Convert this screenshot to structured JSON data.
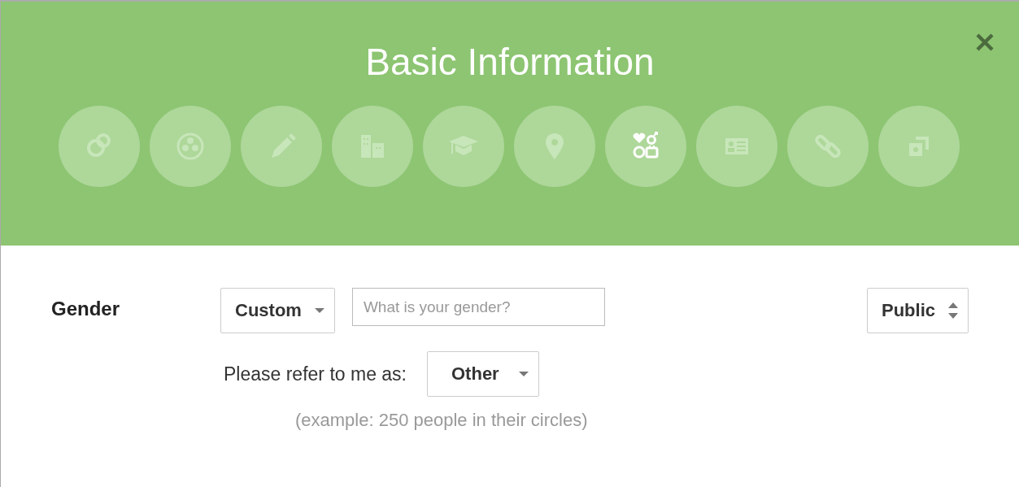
{
  "dialog": {
    "title": "Basic Information",
    "steps": [
      {
        "kind": "rings",
        "selected": false
      },
      {
        "kind": "circles",
        "selected": false
      },
      {
        "kind": "pencil",
        "selected": false
      },
      {
        "kind": "buildings",
        "selected": false
      },
      {
        "kind": "cap",
        "selected": false
      },
      {
        "kind": "pin",
        "selected": false
      },
      {
        "kind": "basics",
        "selected": true
      },
      {
        "kind": "card",
        "selected": false
      },
      {
        "kind": "link",
        "selected": false
      },
      {
        "kind": "photos",
        "selected": false
      }
    ]
  },
  "gender": {
    "label": "Gender",
    "select": "Custom",
    "field": {
      "placeholder": "What is your gender?"
    },
    "visibility": "Public",
    "refer_label": "Please refer to me as:",
    "refer_select": "Other",
    "example": "(example: 250 people in their circles)"
  }
}
